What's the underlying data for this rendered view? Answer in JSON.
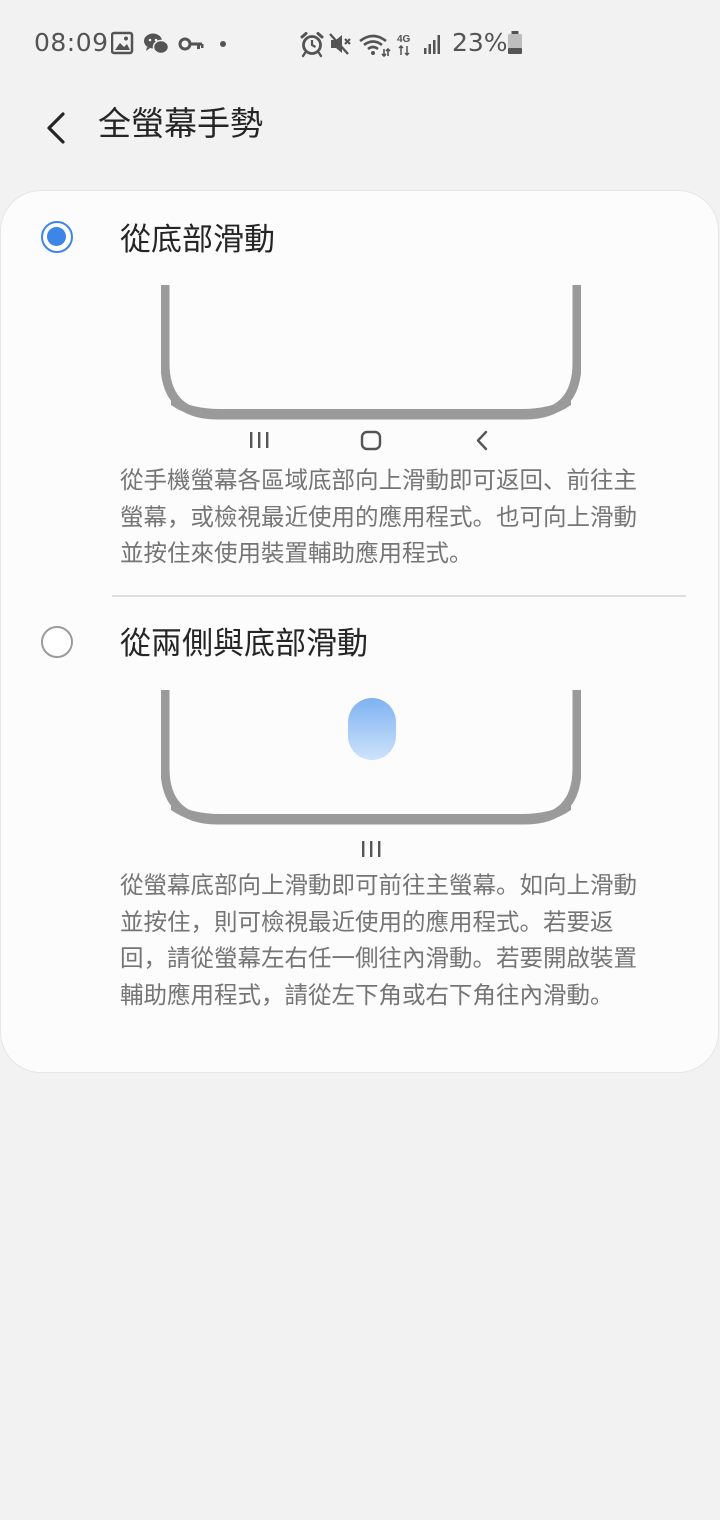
{
  "status_bar": {
    "time": "08:09",
    "battery_percent": "23%",
    "left_icons": [
      "gallery-icon",
      "wechat-icon",
      "vpn-key-icon",
      "dot-icon"
    ],
    "right_icons": [
      "alarm-icon",
      "mute-icon",
      "wifi-icon",
      "4g-icon",
      "signal-icon",
      "battery-icon"
    ],
    "network_label": "4G"
  },
  "app_bar": {
    "title": "全螢幕手勢",
    "back_icon": "back-chevron-icon"
  },
  "options": [
    {
      "title": "從底部滑動",
      "selected": true,
      "nav_icons": [
        "recents-icon",
        "home-icon",
        "back-icon"
      ],
      "description": "從手機螢幕各區域底部向上滑動即可返回、前往主螢幕，或檢視最近使用的應用程式。也可向上滑動並按住來使用裝置輔助應用程式。"
    },
    {
      "title": "從兩側與底部滑動",
      "selected": false,
      "nav_icons": [
        "recents-icon"
      ],
      "description": "從螢幕底部向上滑動即可前往主螢幕。如向上滑動並按住，則可檢視最近使用的應用程式。若要返回，請從螢幕左右任一側往內滑動。若要開啟裝置輔助應用程式，請從左下角或右下角往內滑動。"
    }
  ],
  "colors": {
    "accent": "#3d86e8",
    "background": "#f2f2f2",
    "card": "#fcfcfc",
    "phone_outline": "#9a9a9a",
    "gesture_blob_top": "#7eb2f2",
    "gesture_blob_bottom": "#cfe3fb"
  }
}
